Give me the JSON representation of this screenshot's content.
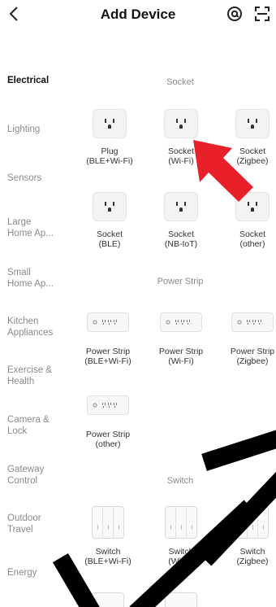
{
  "header": {
    "back_icon": "chevron-left-icon",
    "title": "Add Device",
    "at_icon": "at-sign-icon",
    "scan_icon": "scan-icon"
  },
  "sidebar": {
    "items": [
      {
        "label": "Electrical"
      },
      {
        "label": "Lighting"
      },
      {
        "label": "Sensors"
      },
      {
        "label": "Large\nHome Ap..."
      },
      {
        "label": "Small\nHome Ap..."
      },
      {
        "label": "Kitchen\nAppliances"
      },
      {
        "label": "Exercise &\nHealth"
      },
      {
        "label": "Camera &\nLock"
      },
      {
        "label": "Gateway\nControl"
      },
      {
        "label": "Outdoor\nTravel"
      },
      {
        "label": "Energy"
      }
    ]
  },
  "sections": {
    "socket": {
      "title": "Socket",
      "tiles": [
        {
          "label": "Plug\n(BLE+Wi-Fi)"
        },
        {
          "label": "Socket\n(Wi-Fi)"
        },
        {
          "label": "Socket\n(Zigbee)"
        },
        {
          "label": "Socket\n(BLE)"
        },
        {
          "label": "Socket\n(NB-IoT)"
        },
        {
          "label": "Socket\n(other)"
        }
      ]
    },
    "power_strip": {
      "title": "Power Strip",
      "tiles": [
        {
          "label": "Power Strip\n(BLE+Wi-Fi)"
        },
        {
          "label": "Power Strip\n(Wi-Fi)"
        },
        {
          "label": "Power Strip\n(Zigbee)"
        },
        {
          "label": "Power Strip\n(other)"
        }
      ]
    },
    "switch": {
      "title": "Switch",
      "tiles": [
        {
          "label": "Switch\n(BLE+Wi-Fi)"
        },
        {
          "label": "Switch\n(Wi-Fi)"
        },
        {
          "label": "Switch\n(Zigbee)"
        }
      ]
    }
  },
  "colors": {
    "arrow": "#e8202a",
    "active_text": "#111111",
    "muted_text": "#8a8a8a"
  }
}
